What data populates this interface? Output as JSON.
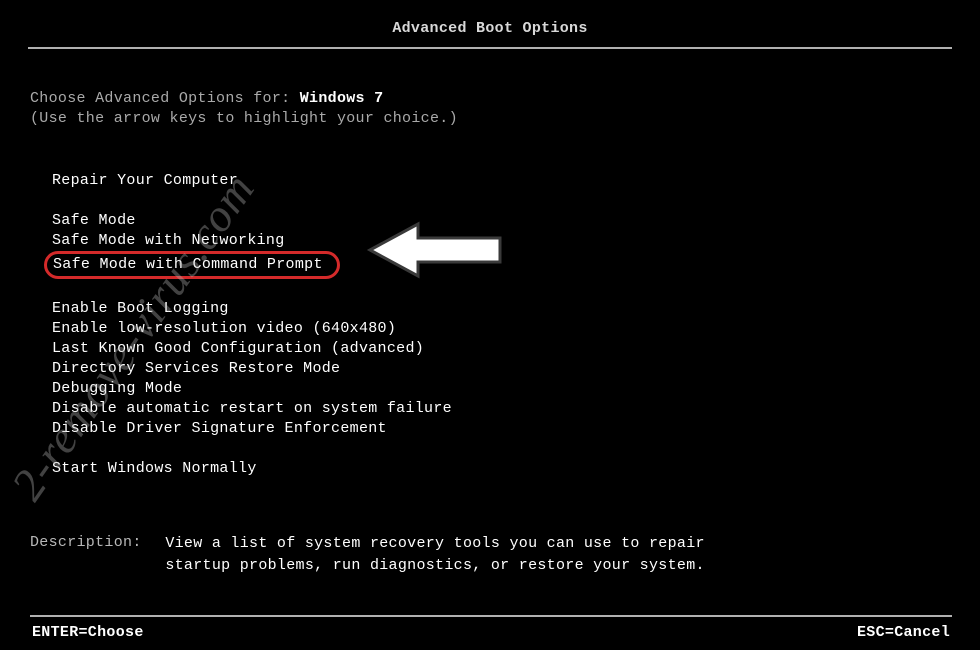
{
  "title": "Advanced Boot Options",
  "intro": {
    "prompt": "Choose Advanced Options for: ",
    "os": "Windows 7",
    "hint": "(Use the arrow keys to highlight your choice.)"
  },
  "menu": {
    "group1": [
      "Repair Your Computer"
    ],
    "group2": [
      "Safe Mode",
      "Safe Mode with Networking",
      "Safe Mode with Command Prompt"
    ],
    "group3": [
      "Enable Boot Logging",
      "Enable low-resolution video (640x480)",
      "Last Known Good Configuration (advanced)",
      "Directory Services Restore Mode",
      "Debugging Mode",
      "Disable automatic restart on system failure",
      "Disable Driver Signature Enforcement"
    ],
    "group4": [
      "Start Windows Normally"
    ],
    "highlighted": "Safe Mode with Command Prompt"
  },
  "description": {
    "label": "Description:",
    "text": "View a list of system recovery tools you can use to repair startup problems, run diagnostics, or restore your system."
  },
  "footer": {
    "left": "ENTER=Choose",
    "right": "ESC=Cancel"
  },
  "watermark": "2-remove-virus.com"
}
